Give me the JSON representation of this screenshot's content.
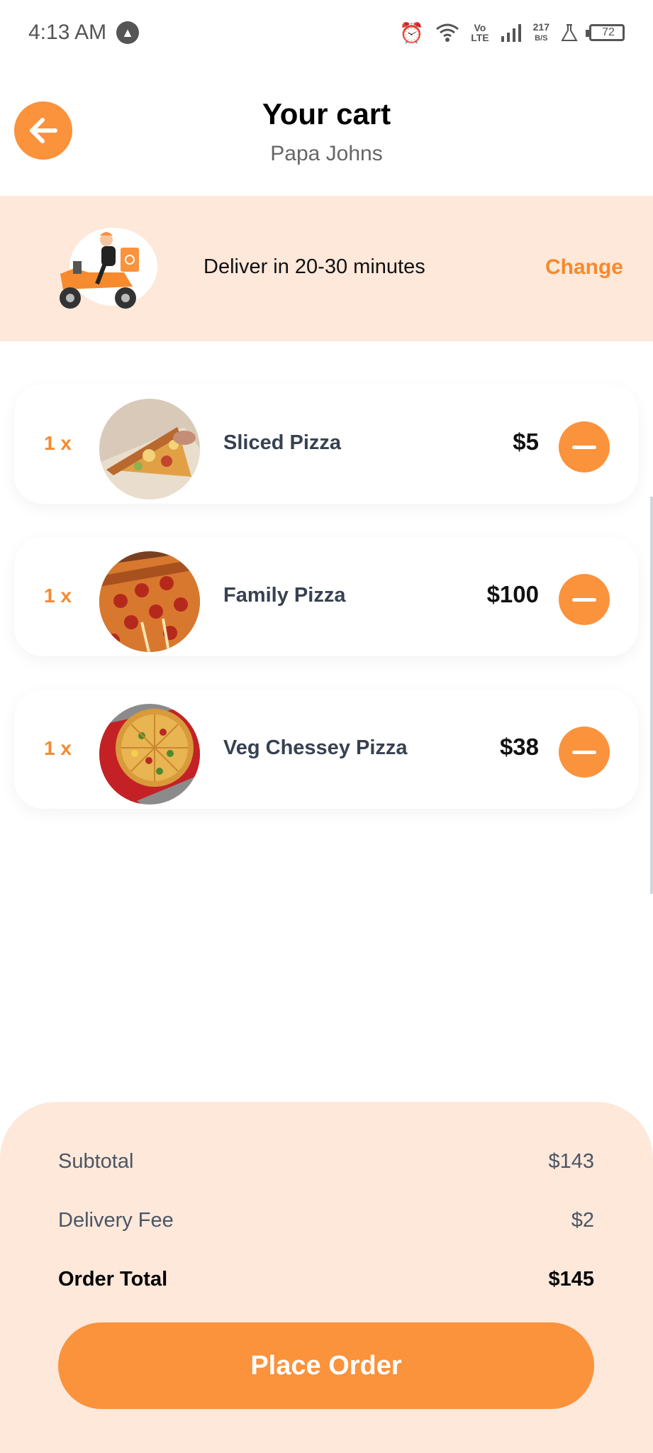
{
  "status_bar": {
    "time": "4:13 AM",
    "network_speed": "217",
    "speed_unit": "B/S",
    "volte_top": "Vo",
    "volte_bottom": "LTE",
    "battery": "72"
  },
  "header": {
    "title": "Your cart",
    "subtitle": "Papa Johns"
  },
  "delivery": {
    "text": "Deliver in 20-30 minutes",
    "change_label": "Change"
  },
  "cart_items": [
    {
      "qty": "1 x",
      "name": "Sliced Pizza",
      "price": "$5",
      "image": "sliced-pizza-photo"
    },
    {
      "qty": "1 x",
      "name": "Family Pizza",
      "price": "$100",
      "image": "family-pizza-photo"
    },
    {
      "qty": "1 x",
      "name": "Veg Chessey Pizza",
      "price": "$38",
      "image": "veg-pizza-photo"
    }
  ],
  "summary": {
    "subtotal_label": "Subtotal",
    "subtotal_value": "$143",
    "delivery_fee_label": "Delivery Fee",
    "delivery_fee_value": "$2",
    "total_label": "Order Total",
    "total_value": "$145",
    "place_order_label": "Place Order"
  },
  "colors": {
    "accent": "#fb923c",
    "banner_bg": "#fde8da"
  }
}
